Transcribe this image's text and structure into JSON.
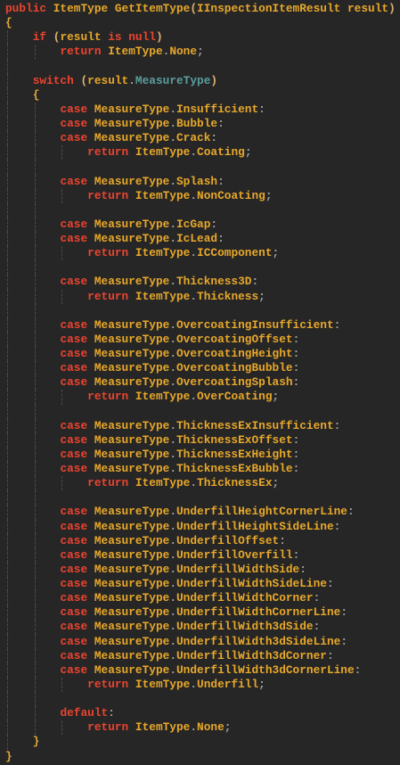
{
  "lines": [
    {
      "lvl": 0,
      "tokens": [
        [
          "k",
          "public"
        ],
        [
          "i",
          " ItemType GetItemType"
        ],
        [
          "p",
          "("
        ],
        [
          "i",
          "IInspectionItemResult result"
        ],
        [
          "p",
          ")"
        ]
      ]
    },
    {
      "lvl": 0,
      "tokens": [
        [
          "b",
          "{"
        ]
      ]
    },
    {
      "lvl": 1,
      "tokens": [
        [
          "k",
          "if"
        ],
        [
          "p",
          " ("
        ],
        [
          "i",
          "result "
        ],
        [
          "k",
          "is null"
        ],
        [
          "p",
          ")"
        ]
      ]
    },
    {
      "lvl": 2,
      "tokens": [
        [
          "k",
          "return"
        ],
        [
          "i",
          " ItemType"
        ],
        [
          "d",
          "."
        ],
        [
          "i",
          "None"
        ],
        [
          "d",
          ";"
        ]
      ]
    },
    {
      "lvl": 1,
      "tokens": []
    },
    {
      "lvl": 1,
      "tokens": [
        [
          "k",
          "switch"
        ],
        [
          "p",
          " ("
        ],
        [
          "i",
          "result"
        ],
        [
          "d",
          "."
        ],
        [
          "t",
          "MeasureType"
        ],
        [
          "p",
          ")"
        ]
      ]
    },
    {
      "lvl": 1,
      "tokens": [
        [
          "b",
          "{"
        ]
      ]
    },
    {
      "lvl": 2,
      "tokens": [
        [
          "k",
          "case"
        ],
        [
          "i",
          " MeasureType"
        ],
        [
          "d",
          "."
        ],
        [
          "i",
          "Insufficient"
        ],
        [
          "d",
          ":"
        ]
      ]
    },
    {
      "lvl": 2,
      "tokens": [
        [
          "k",
          "case"
        ],
        [
          "i",
          " MeasureType"
        ],
        [
          "d",
          "."
        ],
        [
          "i",
          "Bubble"
        ],
        [
          "d",
          ":"
        ]
      ]
    },
    {
      "lvl": 2,
      "tokens": [
        [
          "k",
          "case"
        ],
        [
          "i",
          " MeasureType"
        ],
        [
          "d",
          "."
        ],
        [
          "i",
          "Crack"
        ],
        [
          "d",
          ":"
        ]
      ]
    },
    {
      "lvl": 3,
      "tokens": [
        [
          "k",
          "return"
        ],
        [
          "i",
          " ItemType"
        ],
        [
          "d",
          "."
        ],
        [
          "i",
          "Coating"
        ],
        [
          "d",
          ";"
        ]
      ]
    },
    {
      "lvl": 2,
      "tokens": []
    },
    {
      "lvl": 2,
      "tokens": [
        [
          "k",
          "case"
        ],
        [
          "i",
          " MeasureType"
        ],
        [
          "d",
          "."
        ],
        [
          "i",
          "Splash"
        ],
        [
          "d",
          ":"
        ]
      ]
    },
    {
      "lvl": 3,
      "tokens": [
        [
          "k",
          "return"
        ],
        [
          "i",
          " ItemType"
        ],
        [
          "d",
          "."
        ],
        [
          "i",
          "NonCoating"
        ],
        [
          "d",
          ";"
        ]
      ]
    },
    {
      "lvl": 2,
      "tokens": []
    },
    {
      "lvl": 2,
      "tokens": [
        [
          "k",
          "case"
        ],
        [
          "i",
          " MeasureType"
        ],
        [
          "d",
          "."
        ],
        [
          "i",
          "IcGap"
        ],
        [
          "d",
          ":"
        ]
      ]
    },
    {
      "lvl": 2,
      "tokens": [
        [
          "k",
          "case"
        ],
        [
          "i",
          " MeasureType"
        ],
        [
          "d",
          "."
        ],
        [
          "i",
          "IcLead"
        ],
        [
          "d",
          ":"
        ]
      ]
    },
    {
      "lvl": 3,
      "tokens": [
        [
          "k",
          "return"
        ],
        [
          "i",
          " ItemType"
        ],
        [
          "d",
          "."
        ],
        [
          "i",
          "ICComponent"
        ],
        [
          "d",
          ";"
        ]
      ]
    },
    {
      "lvl": 2,
      "tokens": []
    },
    {
      "lvl": 2,
      "tokens": [
        [
          "k",
          "case"
        ],
        [
          "i",
          " MeasureType"
        ],
        [
          "d",
          "."
        ],
        [
          "i",
          "Thickness3D"
        ],
        [
          "d",
          ":"
        ]
      ]
    },
    {
      "lvl": 3,
      "tokens": [
        [
          "k",
          "return"
        ],
        [
          "i",
          " ItemType"
        ],
        [
          "d",
          "."
        ],
        [
          "i",
          "Thickness"
        ],
        [
          "d",
          ";"
        ]
      ]
    },
    {
      "lvl": 2,
      "tokens": []
    },
    {
      "lvl": 2,
      "tokens": [
        [
          "k",
          "case"
        ],
        [
          "i",
          " MeasureType"
        ],
        [
          "d",
          "."
        ],
        [
          "i",
          "OvercoatingInsufficient"
        ],
        [
          "d",
          ":"
        ]
      ]
    },
    {
      "lvl": 2,
      "tokens": [
        [
          "k",
          "case"
        ],
        [
          "i",
          " MeasureType"
        ],
        [
          "d",
          "."
        ],
        [
          "i",
          "OvercoatingOffset"
        ],
        [
          "d",
          ":"
        ]
      ]
    },
    {
      "lvl": 2,
      "tokens": [
        [
          "k",
          "case"
        ],
        [
          "i",
          " MeasureType"
        ],
        [
          "d",
          "."
        ],
        [
          "i",
          "OvercoatingHeight"
        ],
        [
          "d",
          ":"
        ]
      ]
    },
    {
      "lvl": 2,
      "tokens": [
        [
          "k",
          "case"
        ],
        [
          "i",
          " MeasureType"
        ],
        [
          "d",
          "."
        ],
        [
          "i",
          "OvercoatingBubble"
        ],
        [
          "d",
          ":"
        ]
      ]
    },
    {
      "lvl": 2,
      "tokens": [
        [
          "k",
          "case"
        ],
        [
          "i",
          " MeasureType"
        ],
        [
          "d",
          "."
        ],
        [
          "i",
          "OvercoatingSplash"
        ],
        [
          "d",
          ":"
        ]
      ]
    },
    {
      "lvl": 3,
      "tokens": [
        [
          "k",
          "return"
        ],
        [
          "i",
          " ItemType"
        ],
        [
          "d",
          "."
        ],
        [
          "i",
          "OverCoating"
        ],
        [
          "d",
          ";"
        ]
      ]
    },
    {
      "lvl": 2,
      "tokens": []
    },
    {
      "lvl": 2,
      "tokens": [
        [
          "k",
          "case"
        ],
        [
          "i",
          " MeasureType"
        ],
        [
          "d",
          "."
        ],
        [
          "i",
          "ThicknessExInsufficient"
        ],
        [
          "d",
          ":"
        ]
      ]
    },
    {
      "lvl": 2,
      "tokens": [
        [
          "k",
          "case"
        ],
        [
          "i",
          " MeasureType"
        ],
        [
          "d",
          "."
        ],
        [
          "i",
          "ThicknessExOffset"
        ],
        [
          "d",
          ":"
        ]
      ]
    },
    {
      "lvl": 2,
      "tokens": [
        [
          "k",
          "case"
        ],
        [
          "i",
          " MeasureType"
        ],
        [
          "d",
          "."
        ],
        [
          "i",
          "ThicknessExHeight"
        ],
        [
          "d",
          ":"
        ]
      ]
    },
    {
      "lvl": 2,
      "tokens": [
        [
          "k",
          "case"
        ],
        [
          "i",
          " MeasureType"
        ],
        [
          "d",
          "."
        ],
        [
          "i",
          "ThicknessExBubble"
        ],
        [
          "d",
          ":"
        ]
      ]
    },
    {
      "lvl": 3,
      "tokens": [
        [
          "k",
          "return"
        ],
        [
          "i",
          " ItemType"
        ],
        [
          "d",
          "."
        ],
        [
          "i",
          "ThicknessEx"
        ],
        [
          "d",
          ";"
        ]
      ]
    },
    {
      "lvl": 2,
      "tokens": []
    },
    {
      "lvl": 2,
      "tokens": [
        [
          "k",
          "case"
        ],
        [
          "i",
          " MeasureType"
        ],
        [
          "d",
          "."
        ],
        [
          "i",
          "UnderfillHeightCornerLine"
        ],
        [
          "d",
          ":"
        ]
      ]
    },
    {
      "lvl": 2,
      "tokens": [
        [
          "k",
          "case"
        ],
        [
          "i",
          " MeasureType"
        ],
        [
          "d",
          "."
        ],
        [
          "i",
          "UnderfillHeightSideLine"
        ],
        [
          "d",
          ":"
        ]
      ]
    },
    {
      "lvl": 2,
      "tokens": [
        [
          "k",
          "case"
        ],
        [
          "i",
          " MeasureType"
        ],
        [
          "d",
          "."
        ],
        [
          "i",
          "UnderfillOffset"
        ],
        [
          "d",
          ":"
        ]
      ]
    },
    {
      "lvl": 2,
      "tokens": [
        [
          "k",
          "case"
        ],
        [
          "i",
          " MeasureType"
        ],
        [
          "d",
          "."
        ],
        [
          "i",
          "UnderfillOverfill"
        ],
        [
          "d",
          ":"
        ]
      ]
    },
    {
      "lvl": 2,
      "tokens": [
        [
          "k",
          "case"
        ],
        [
          "i",
          " MeasureType"
        ],
        [
          "d",
          "."
        ],
        [
          "i",
          "UnderfillWidthSide"
        ],
        [
          "d",
          ":"
        ]
      ]
    },
    {
      "lvl": 2,
      "tokens": [
        [
          "k",
          "case"
        ],
        [
          "i",
          " MeasureType"
        ],
        [
          "d",
          "."
        ],
        [
          "i",
          "UnderfillWidthSideLine"
        ],
        [
          "d",
          ":"
        ]
      ]
    },
    {
      "lvl": 2,
      "tokens": [
        [
          "k",
          "case"
        ],
        [
          "i",
          " MeasureType"
        ],
        [
          "d",
          "."
        ],
        [
          "i",
          "UnderfillWidthCorner"
        ],
        [
          "d",
          ":"
        ]
      ]
    },
    {
      "lvl": 2,
      "tokens": [
        [
          "k",
          "case"
        ],
        [
          "i",
          " MeasureType"
        ],
        [
          "d",
          "."
        ],
        [
          "i",
          "UnderfillWidthCornerLine"
        ],
        [
          "d",
          ":"
        ]
      ]
    },
    {
      "lvl": 2,
      "tokens": [
        [
          "k",
          "case"
        ],
        [
          "i",
          " MeasureType"
        ],
        [
          "d",
          "."
        ],
        [
          "i",
          "UnderfillWidth3dSide"
        ],
        [
          "d",
          ":"
        ]
      ]
    },
    {
      "lvl": 2,
      "tokens": [
        [
          "k",
          "case"
        ],
        [
          "i",
          " MeasureType"
        ],
        [
          "d",
          "."
        ],
        [
          "i",
          "UnderfillWidth3dSideLine"
        ],
        [
          "d",
          ":"
        ]
      ]
    },
    {
      "lvl": 2,
      "tokens": [
        [
          "k",
          "case"
        ],
        [
          "i",
          " MeasureType"
        ],
        [
          "d",
          "."
        ],
        [
          "i",
          "UnderfillWidth3dCorner"
        ],
        [
          "d",
          ":"
        ]
      ]
    },
    {
      "lvl": 2,
      "tokens": [
        [
          "k",
          "case"
        ],
        [
          "i",
          " MeasureType"
        ],
        [
          "d",
          "."
        ],
        [
          "i",
          "UnderfillWidth3dCornerLine"
        ],
        [
          "d",
          ":"
        ]
      ]
    },
    {
      "lvl": 3,
      "tokens": [
        [
          "k",
          "return"
        ],
        [
          "i",
          " ItemType"
        ],
        [
          "d",
          "."
        ],
        [
          "i",
          "Underfill"
        ],
        [
          "d",
          ";"
        ]
      ]
    },
    {
      "lvl": 2,
      "tokens": []
    },
    {
      "lvl": 2,
      "tokens": [
        [
          "k",
          "default"
        ],
        [
          "d",
          ":"
        ]
      ]
    },
    {
      "lvl": 3,
      "tokens": [
        [
          "k",
          "return"
        ],
        [
          "i",
          " ItemType"
        ],
        [
          "d",
          "."
        ],
        [
          "i",
          "None"
        ],
        [
          "d",
          ";"
        ]
      ]
    },
    {
      "lvl": 1,
      "tokens": [
        [
          "b",
          "}"
        ]
      ]
    },
    {
      "lvl": 0,
      "tokens": [
        [
          "b",
          "}"
        ]
      ]
    }
  ]
}
